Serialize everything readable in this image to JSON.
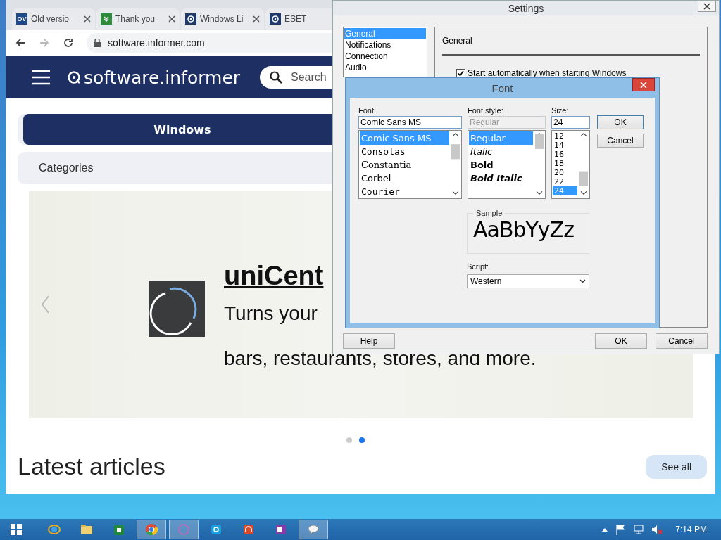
{
  "browser": {
    "tabs": [
      {
        "label": "Old versio",
        "kind": "badge",
        "badge": "OV",
        "selected": false
      },
      {
        "label": "Thank you",
        "kind": "check",
        "selected": false
      },
      {
        "label": "Windows Li",
        "kind": "ring",
        "selected": false
      },
      {
        "label": "ESET",
        "kind": "ring",
        "selected": false
      }
    ],
    "address": "software.informer.com",
    "site": {
      "logo": "software.informer",
      "search_placeholder": "Search",
      "nav": [
        {
          "label": "Windows",
          "selected": true
        }
      ],
      "categories": "Categories",
      "hero": {
        "title": "uniCent",
        "line_1": "Turns your",
        "line_2": "bars, restaurants, stores, and more."
      },
      "dots": [
        {
          "selected": false
        },
        {
          "selected": true
        }
      ],
      "section_title": "Latest articles",
      "see_all": "See all"
    }
  },
  "settings": {
    "title": "Settings",
    "nav": [
      {
        "label": "General",
        "selected": true
      },
      {
        "label": "Notifications",
        "selected": false
      },
      {
        "label": "Connection",
        "selected": false
      },
      {
        "label": "Audio",
        "selected": false
      }
    ],
    "panel_title": "General",
    "options": [
      {
        "label": "Start automatically when starting Windows",
        "checked": true
      }
    ],
    "buttons": [
      {
        "label": "Help",
        "kind": "left"
      },
      {
        "label": "OK",
        "kind": "right"
      },
      {
        "label": "Cancel",
        "kind": "right"
      }
    ]
  },
  "font_dialog": {
    "title": "Font",
    "font": {
      "label": "Font:",
      "value": "Comic Sans MS",
      "disabled": false,
      "items": [
        {
          "label": "Comic Sans MS",
          "selected": true,
          "kind": "sans"
        },
        {
          "label": "Consolas",
          "selected": false,
          "kind": "mono"
        },
        {
          "label": "Constantia",
          "selected": false,
          "kind": "serif"
        },
        {
          "label": "Corbel",
          "selected": false,
          "kind": "sans"
        },
        {
          "label": "Courier",
          "selected": false,
          "kind": "mono"
        }
      ]
    },
    "style": {
      "label": "Font style:",
      "value": "Regular",
      "disabled": true,
      "items": [
        {
          "label": "Regular",
          "selected": true,
          "kind": "regular"
        },
        {
          "label": "Italic",
          "selected": false,
          "kind": "italic"
        },
        {
          "label": "Bold",
          "selected": false,
          "kind": "bold"
        },
        {
          "label": "Bold Italic",
          "selected": false,
          "kind": "bold-italic"
        }
      ]
    },
    "size": {
      "label": "Size:",
      "value": "24",
      "disabled": false,
      "items": [
        {
          "label": "12",
          "selected": false
        },
        {
          "label": "14",
          "selected": false
        },
        {
          "label": "16",
          "selected": false
        },
        {
          "label": "18",
          "selected": false
        },
        {
          "label": "20",
          "selected": false
        },
        {
          "label": "22",
          "selected": false
        },
        {
          "label": "24",
          "selected": true
        }
      ]
    },
    "buttons": [
      {
        "label": "OK",
        "selected": true
      },
      {
        "label": "Cancel",
        "selected": false
      }
    ],
    "sample": {
      "label": "Sample",
      "text": "AaBbYyZz"
    },
    "script": {
      "label": "Script:",
      "value": "Western"
    }
  },
  "taskbar": {
    "apps": [
      {
        "kind": "explorer-e",
        "active": false
      },
      {
        "kind": "folder",
        "active": false
      },
      {
        "kind": "store",
        "active": false
      },
      {
        "kind": "chrome",
        "active": true
      },
      {
        "kind": "ring",
        "active": true
      },
      {
        "kind": "skype",
        "active": false
      },
      {
        "kind": "headphones",
        "active": false
      },
      {
        "kind": "notes",
        "active": false
      },
      {
        "kind": "chat",
        "active": true
      }
    ],
    "clock": "7:14 PM"
  }
}
